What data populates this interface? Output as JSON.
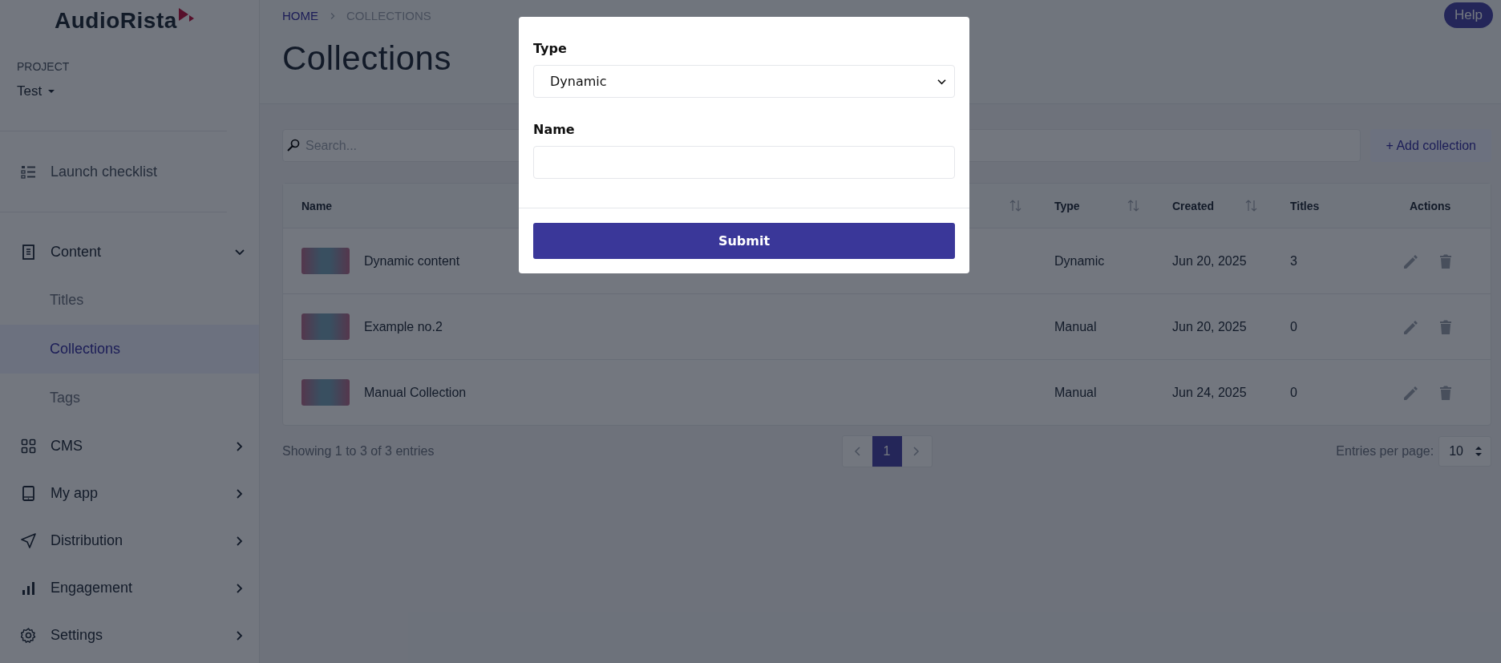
{
  "logo": "AudioRista",
  "project": {
    "label": "PROJECT",
    "value": "Test"
  },
  "sidebar": {
    "items": [
      {
        "kind": "link",
        "label": "Launch checklist"
      },
      {
        "kind": "group",
        "label": "Content",
        "expanded": true,
        "children": [
          {
            "label": "Titles",
            "selected": false
          },
          {
            "label": "Collections",
            "selected": true
          },
          {
            "label": "Tags",
            "selected": false
          }
        ]
      },
      {
        "kind": "group",
        "label": "CMS",
        "expanded": false
      },
      {
        "kind": "group",
        "label": "My app",
        "expanded": false
      },
      {
        "kind": "group",
        "label": "Distribution",
        "expanded": false
      },
      {
        "kind": "group",
        "label": "Engagement",
        "expanded": false
      },
      {
        "kind": "group",
        "label": "Settings",
        "expanded": false
      }
    ]
  },
  "breadcrumb": [
    "HOME",
    "COLLECTIONS"
  ],
  "help_button": "Help",
  "title": "Collections",
  "search": {
    "placeholder": "Search..."
  },
  "add_button": "+ Add collection",
  "table": {
    "columns": [
      {
        "label": "Name",
        "sortable": true
      },
      {
        "label": "Type",
        "sortable": true
      },
      {
        "label": "Created",
        "sortable": true
      },
      {
        "label": "Titles",
        "sortable": false
      },
      {
        "label": "Actions",
        "sortable": false
      }
    ],
    "rows": [
      {
        "name": "Dynamic content",
        "type": "Dynamic",
        "created": "Jun 20, 2025",
        "titles": "3"
      },
      {
        "name": "Example no.2",
        "type": "Manual",
        "created": "Jun 20, 2025",
        "titles": "0"
      },
      {
        "name": "Manual Collection",
        "type": "Manual",
        "created": "Jun 24, 2025",
        "titles": "0"
      }
    ]
  },
  "footer": {
    "summary": "Showing 1 to 3 of 3 entries",
    "pages": [
      {
        "label": "1",
        "selected": true
      }
    ],
    "entries_label": "Entries per page:",
    "entries_value": "10"
  },
  "modal": {
    "fields": [
      {
        "kind": "select",
        "label": "Type",
        "value": "Dynamic"
      },
      {
        "kind": "text",
        "label": "Name"
      }
    ],
    "submit": "Submit"
  }
}
